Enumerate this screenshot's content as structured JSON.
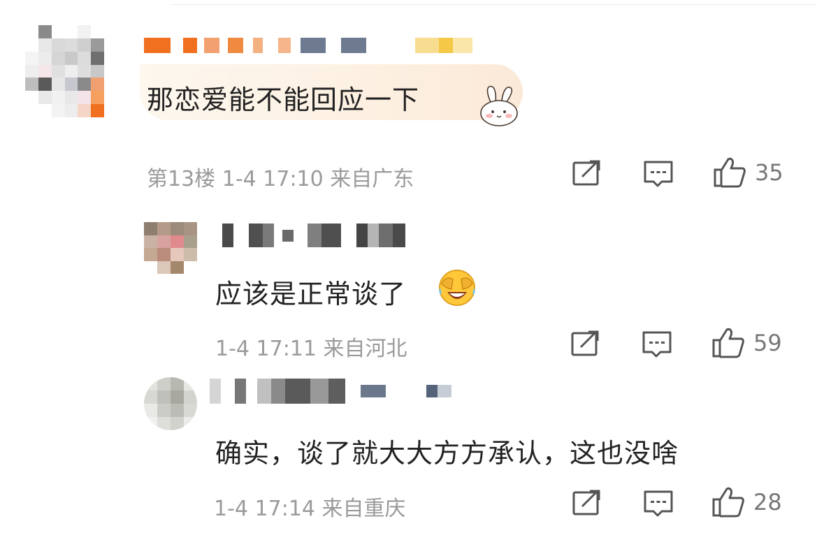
{
  "comments": [
    {
      "content": "那恋爱能不能回应一下",
      "floor": "第13楼",
      "time": "1-4 17:10",
      "location": "来自广东",
      "likes": "35"
    },
    {
      "content": "应该是正常谈了",
      "time": "1-4 17:11",
      "location": "来自河北",
      "likes": "59"
    },
    {
      "content": "确实，谈了就大大方方承认，这也没啥",
      "time": "1-4 17:14",
      "location": "来自重庆",
      "likes": "28"
    }
  ],
  "icons": {
    "repost": "repost-icon",
    "comment": "comment-icon",
    "like": "like-icon",
    "emoji": "laughing-crying-emoji-icon",
    "bunny": "bunny-sticker-icon"
  },
  "colors": {
    "text": "#222222",
    "meta": "#9a9a9a",
    "icon": "#555555",
    "bubble": "#fdf3e6"
  }
}
